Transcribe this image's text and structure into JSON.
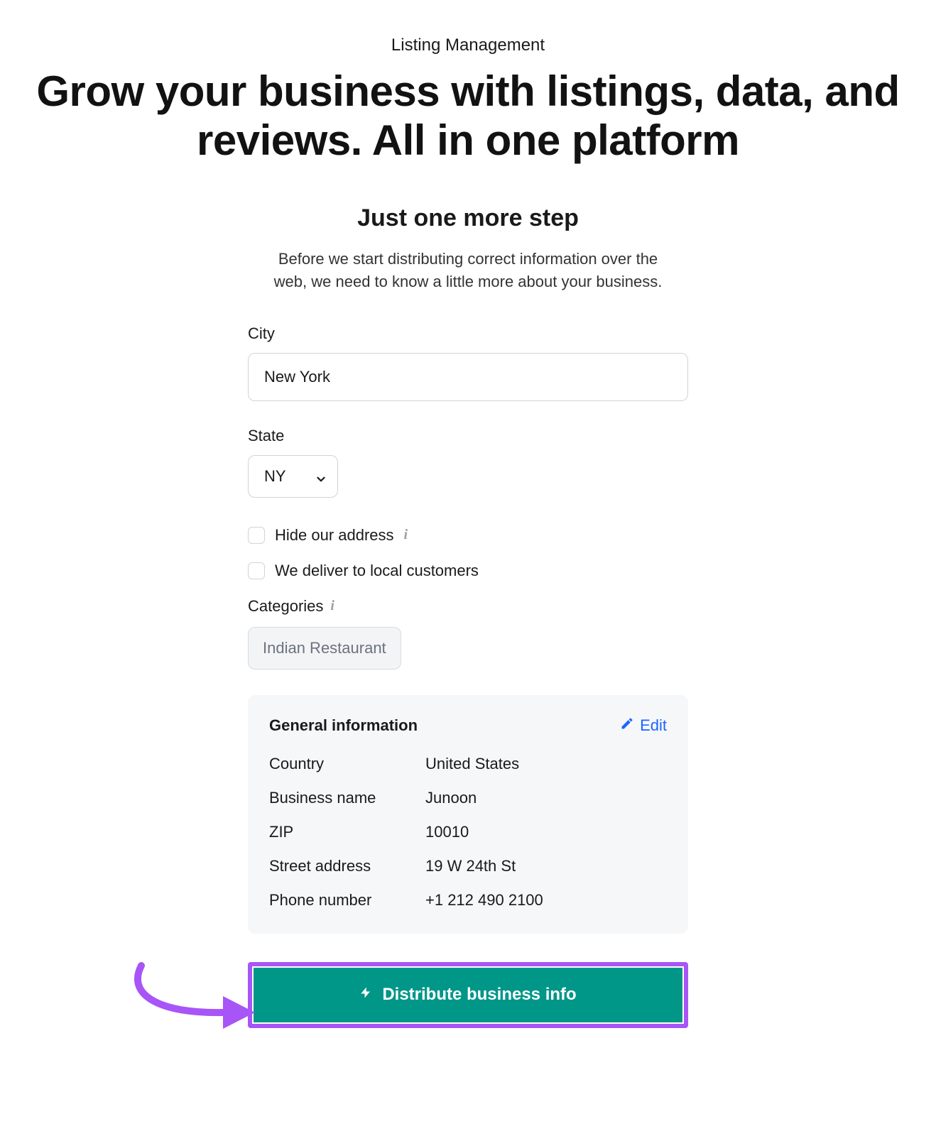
{
  "breadcrumb": "Listing Management",
  "hero": "Grow your business with listings, data, and reviews. All in one platform",
  "subheading": "Just one more step",
  "subtext": "Before we start distributing correct information over the web, we need to know a little more about your business.",
  "fields": {
    "city_label": "City",
    "city_value": "New York",
    "state_label": "State",
    "state_value": "NY",
    "hide_address_label": "Hide our address",
    "deliver_label": "We deliver to local customers",
    "categories_label": "Categories",
    "category_tag": "Indian Restaurant"
  },
  "card": {
    "title": "General information",
    "edit_label": "Edit",
    "rows": {
      "country_k": "Country",
      "country_v": "United States",
      "business_k": "Business name",
      "business_v": "Junoon",
      "zip_k": "ZIP",
      "zip_v": "10010",
      "street_k": "Street address",
      "street_v": "19 W 24th St",
      "phone_k": "Phone number",
      "phone_v": "+1 212 490 2100"
    }
  },
  "cta_label": "Distribute business info"
}
